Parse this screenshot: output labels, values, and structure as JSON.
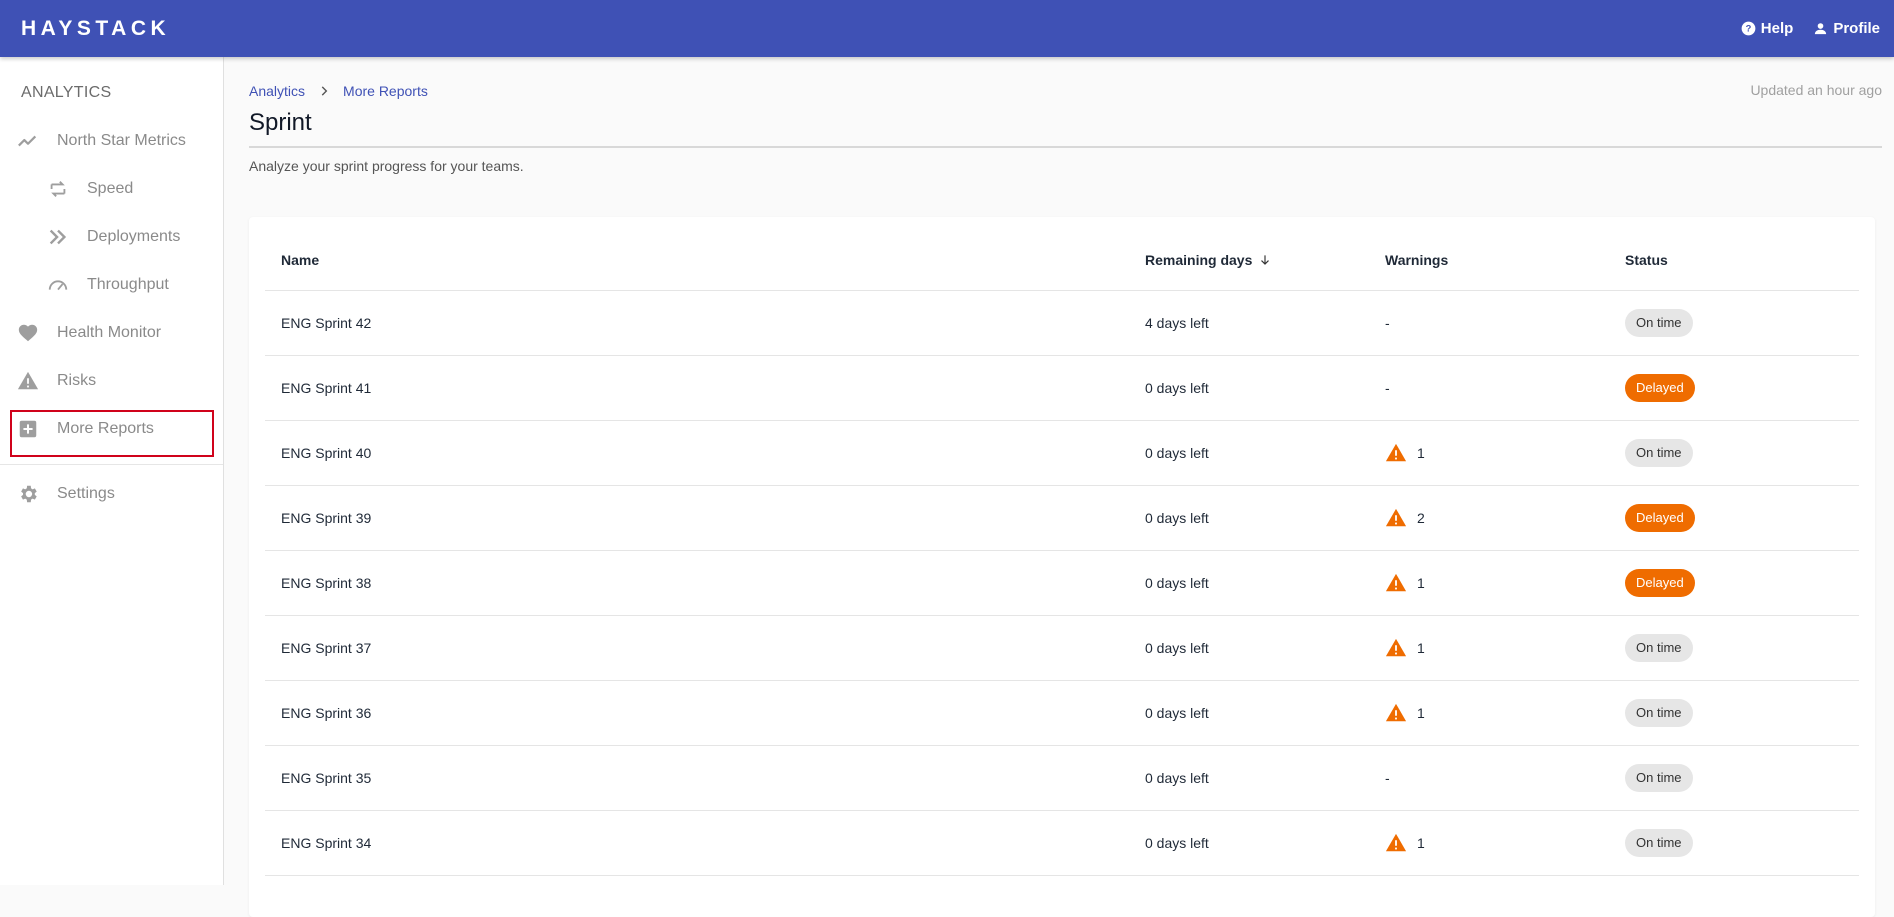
{
  "header": {
    "logo": "HAYSTACK",
    "help_label": "Help",
    "profile_label": "Profile"
  },
  "sidebar": {
    "heading": "ANALYTICS",
    "items": [
      {
        "label": "North Star Metrics",
        "icon": "trending-line-icon",
        "level": 1
      },
      {
        "label": "Speed",
        "icon": "repeat-icon",
        "level": 2
      },
      {
        "label": "Deployments",
        "icon": "double-chevron-right-icon",
        "level": 2
      },
      {
        "label": "Throughput",
        "icon": "speedometer-icon",
        "level": 2
      },
      {
        "label": "Health Monitor",
        "icon": "heart-icon",
        "level": 1
      },
      {
        "label": "Risks",
        "icon": "warning-icon",
        "level": 1
      },
      {
        "label": "More Reports",
        "icon": "plus-box-icon",
        "level": 1,
        "highlighted": true
      },
      {
        "label": "Settings",
        "icon": "gear-icon",
        "level": 1
      }
    ]
  },
  "breadcrumb": {
    "items": [
      "Analytics",
      "More Reports"
    ]
  },
  "updated": "Updated an hour ago",
  "page": {
    "title": "Sprint",
    "subtitle": "Analyze your sprint progress for your teams."
  },
  "table": {
    "columns": [
      "Name",
      "Remaining days",
      "Warnings",
      "Status"
    ],
    "sort_column": "Remaining days",
    "sort_direction": "descending",
    "rows": [
      {
        "name": "ENG Sprint 42",
        "days": "4 days left",
        "warnings": "-",
        "status": "On time"
      },
      {
        "name": "ENG Sprint 41",
        "days": "0 days left",
        "warnings": "-",
        "status": "Delayed"
      },
      {
        "name": "ENG Sprint 40",
        "days": "0 days left",
        "warnings": "1",
        "status": "On time"
      },
      {
        "name": "ENG Sprint 39",
        "days": "0 days left",
        "warnings": "2",
        "status": "Delayed"
      },
      {
        "name": "ENG Sprint 38",
        "days": "0 days left",
        "warnings": "1",
        "status": "Delayed"
      },
      {
        "name": "ENG Sprint 37",
        "days": "0 days left",
        "warnings": "1",
        "status": "On time"
      },
      {
        "name": "ENG Sprint 36",
        "days": "0 days left",
        "warnings": "1",
        "status": "On time"
      },
      {
        "name": "ENG Sprint 35",
        "days": "0 days left",
        "warnings": "-",
        "status": "On time"
      },
      {
        "name": "ENG Sprint 34",
        "days": "0 days left",
        "warnings": "1",
        "status": "On time"
      }
    ]
  },
  "colors": {
    "brand": "#3f51b5",
    "delayed": "#ef6c00",
    "on_time": "#e6e6e6",
    "warning_icon": "#ef6c00",
    "highlight_outline": "#d0021b"
  }
}
